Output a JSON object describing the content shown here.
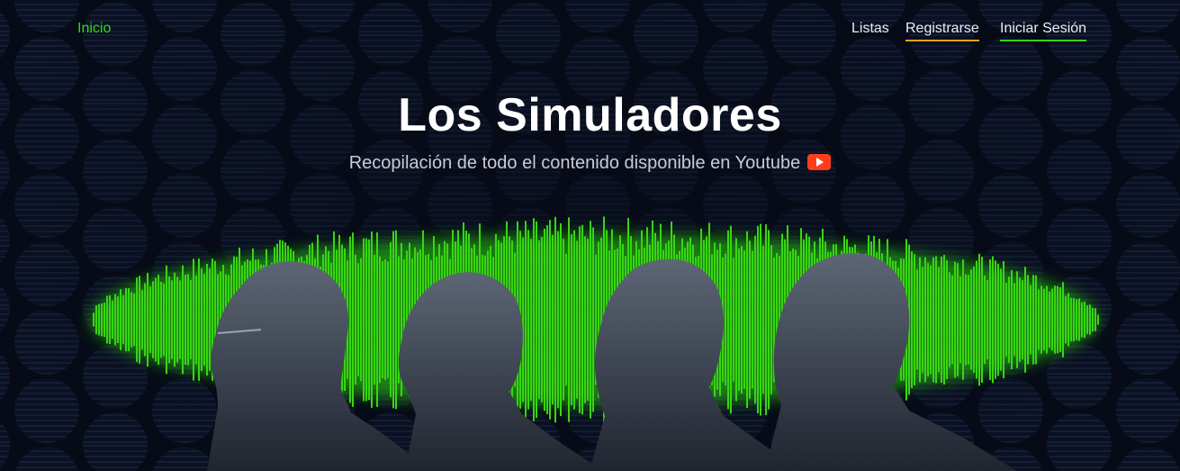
{
  "nav": {
    "home_label": "Inicio",
    "lists_label": "Listas",
    "register_label": "Registrarse",
    "login_label": "Iniciar Sesión"
  },
  "hero": {
    "title": "Los Simuladores",
    "subtitle": "Recopilación de todo el contenido disponible en Youtube",
    "subtitle_icon": "youtube-icon"
  },
  "colors": {
    "background": "#070b17",
    "accent_green": "#33d611",
    "register_underline": "#e3a11c",
    "youtube_red": "#ff3d1b"
  }
}
